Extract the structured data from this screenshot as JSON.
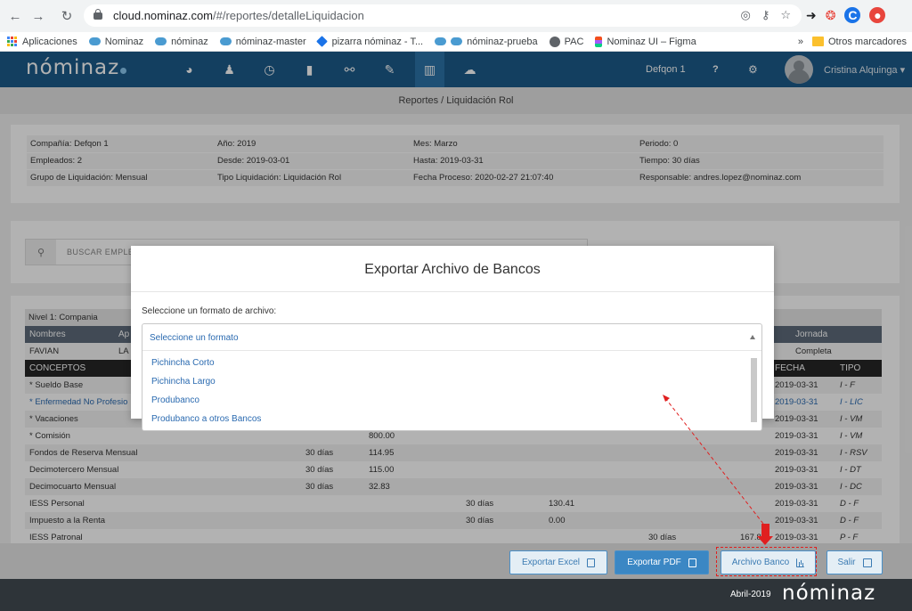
{
  "browser": {
    "url_host": "cloud.nominaz.com",
    "url_path": "/#/reportes/detalleLiquidacion",
    "bookmarks": [
      "Aplicaciones",
      "Nominaz",
      "nóminaz",
      "nóminaz-master",
      "pizarra nóminaz - T...",
      "nóminaz-prueba",
      "PAC",
      "Nominaz UI – Figma"
    ],
    "more": "»",
    "other_bookmarks": "Otros marcadores",
    "profile_letter": "C"
  },
  "app": {
    "logo": "nóminaz",
    "company": "Defqon 1",
    "help": "?",
    "user": "Cristina Alquinga ▾",
    "breadcrumb": "Reportes / Liquidación Rol"
  },
  "info": {
    "rows": [
      [
        "Compañía: Defqon 1",
        "Año: 2019",
        "Mes: Marzo",
        "Periodo: 0"
      ],
      [
        "Empleados: 2",
        "Desde: 2019-03-01",
        "Hasta: 2019-03-31",
        "Tiempo: 30 días"
      ],
      [
        "Grupo de Liquidación: Mensual",
        "Tipo Liquidación: Liquidación Rol",
        "Fecha Proceso: 2020-02-27 21:07:40",
        "Responsable: andres.lopez@nominaz.com"
      ]
    ]
  },
  "search": {
    "placeholder": "BUSCAR EMPLE"
  },
  "table": {
    "nivel": "Nivel 1: Compania",
    "emp_headers": {
      "nombres": "Nombres",
      "ap": "Ap",
      "jornada": "Jornada"
    },
    "emp_row": {
      "nombre": "FAVIAN",
      "ap": "LA",
      "jornada": "Completa"
    },
    "con_headers": {
      "conceptos": "CONCEPTOS",
      "fecha": "FECHA",
      "tipo": "TIPO"
    },
    "rows": [
      {
        "concepto": "* Sueldo Base",
        "c1": "",
        "c2": "",
        "c3": "",
        "c4": "",
        "c5": "",
        "c6": "",
        "fecha": "2019-03-31",
        "tipo": "I - F",
        "blue": false
      },
      {
        "concepto": "* Enfermedad No Profesio",
        "c1": "",
        "c2": "",
        "c3": "",
        "c4": "",
        "c5": "",
        "c6": "",
        "fecha": "2019-03-31",
        "tipo": "I - LIC",
        "blue": true
      },
      {
        "concepto": "* Vacaciones",
        "c1": "",
        "c2": "",
        "c3": "",
        "c4": "",
        "c5": "",
        "c6": "",
        "fecha": "2019-03-31",
        "tipo": "I - VM",
        "blue": false
      },
      {
        "concepto": "* Comisión",
        "c1": "",
        "c2": "800.00",
        "c3": "",
        "c4": "",
        "c5": "",
        "c6": "",
        "fecha": "2019-03-31",
        "tipo": "I - VM",
        "blue": false
      },
      {
        "concepto": "Fondos de Reserva Mensual",
        "c1": "30 días",
        "c2": "114.95",
        "c3": "",
        "c4": "",
        "c5": "",
        "c6": "",
        "fecha": "2019-03-31",
        "tipo": "I - RSV",
        "blue": false
      },
      {
        "concepto": "Decimotercero Mensual",
        "c1": "30 días",
        "c2": "115.00",
        "c3": "",
        "c4": "",
        "c5": "",
        "c6": "",
        "fecha": "2019-03-31",
        "tipo": "I - DT",
        "blue": false
      },
      {
        "concepto": "Decimocuarto Mensual",
        "c1": "30 días",
        "c2": "32.83",
        "c3": "",
        "c4": "",
        "c5": "",
        "c6": "",
        "fecha": "2019-03-31",
        "tipo": "I - DC",
        "blue": false
      },
      {
        "concepto": "IESS Personal",
        "c1": "",
        "c2": "",
        "c3": "30 días",
        "c4": "130.41",
        "c5": "",
        "c6": "",
        "fecha": "2019-03-31",
        "tipo": "D - F",
        "blue": false
      },
      {
        "concepto": "Impuesto a la Renta",
        "c1": "",
        "c2": "",
        "c3": "30 días",
        "c4": "0.00",
        "c5": "",
        "c6": "",
        "fecha": "2019-03-31",
        "tipo": "D - F",
        "blue": false
      },
      {
        "concepto": "IESS Patronal",
        "c1": "",
        "c2": "",
        "c3": "",
        "c4": "",
        "c5": "30 días",
        "c6": "167.82",
        "fecha": "2019-03-31",
        "tipo": "P - F",
        "blue": false
      }
    ]
  },
  "footer": {
    "excel": "Exportar Excel",
    "pdf": "Exportar PDF",
    "banco": "Archivo Banco",
    "salir": "Salir",
    "version": "Abril-2019",
    "logo": "nóminaz"
  },
  "modal": {
    "title": "Exportar Archivo de Bancos",
    "label": "Seleccione un formato de archivo:",
    "selected": "Seleccione un formato",
    "options": [
      "Pichincha Corto",
      "Pichincha Largo",
      "Produbanco",
      "Produbanco a otros Bancos"
    ]
  }
}
